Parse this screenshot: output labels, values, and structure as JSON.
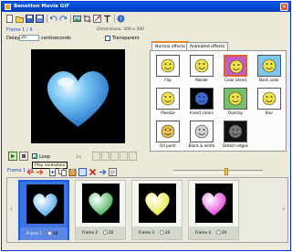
{
  "app": {
    "title": "Benetton Movie GIF"
  },
  "editor": {
    "frame_label": "Frame 1 / 4",
    "dimensions": "Dimensions: 300 x 300",
    "delay_label": "Delay",
    "delay_value": "20",
    "delay_unit": "centiseconds",
    "transparent_label": "Transparent",
    "loop_label": "Loop",
    "zoom": "1x"
  },
  "tabs": [
    {
      "label": "Normal effects"
    },
    {
      "label": "Animated effects"
    }
  ],
  "effects": [
    {
      "label": "Flip",
      "icon": "smiley-flip-icon"
    },
    {
      "label": "Rotate",
      "icon": "smiley-rotate-icon"
    },
    {
      "label": "Color blend",
      "icon": "smiley-color-blend-icon"
    },
    {
      "label": "Back color",
      "icon": "smiley-back-color-icon"
    },
    {
      "label": "Pixelize",
      "icon": "smiley-pixelize-icon"
    },
    {
      "label": "Invert colors",
      "icon": "smiley-invert-icon"
    },
    {
      "label": "Overlay",
      "icon": "smiley-overlay-icon"
    },
    {
      "label": "Blur",
      "icon": "smiley-blur-icon"
    },
    {
      "label": "Oil paint",
      "icon": "smiley-oil-paint-icon"
    },
    {
      "label": "Black & white",
      "icon": "smiley-bw-icon"
    },
    {
      "label": "Detect edges",
      "icon": "smiley-edges-icon"
    }
  ],
  "tooltip": "Play animation",
  "frame_count": "Frame 1 / 4",
  "frames": [
    {
      "label": "Frame 1",
      "delay": "20",
      "color": "#3a9ee8"
    },
    {
      "label": "Frame 2",
      "delay": "20",
      "color": "#2aa844"
    },
    {
      "label": "Frame 3",
      "delay": "20",
      "color": "#e8e82a"
    },
    {
      "label": "Frame 4",
      "delay": "20",
      "color": "#e02ad8"
    }
  ]
}
